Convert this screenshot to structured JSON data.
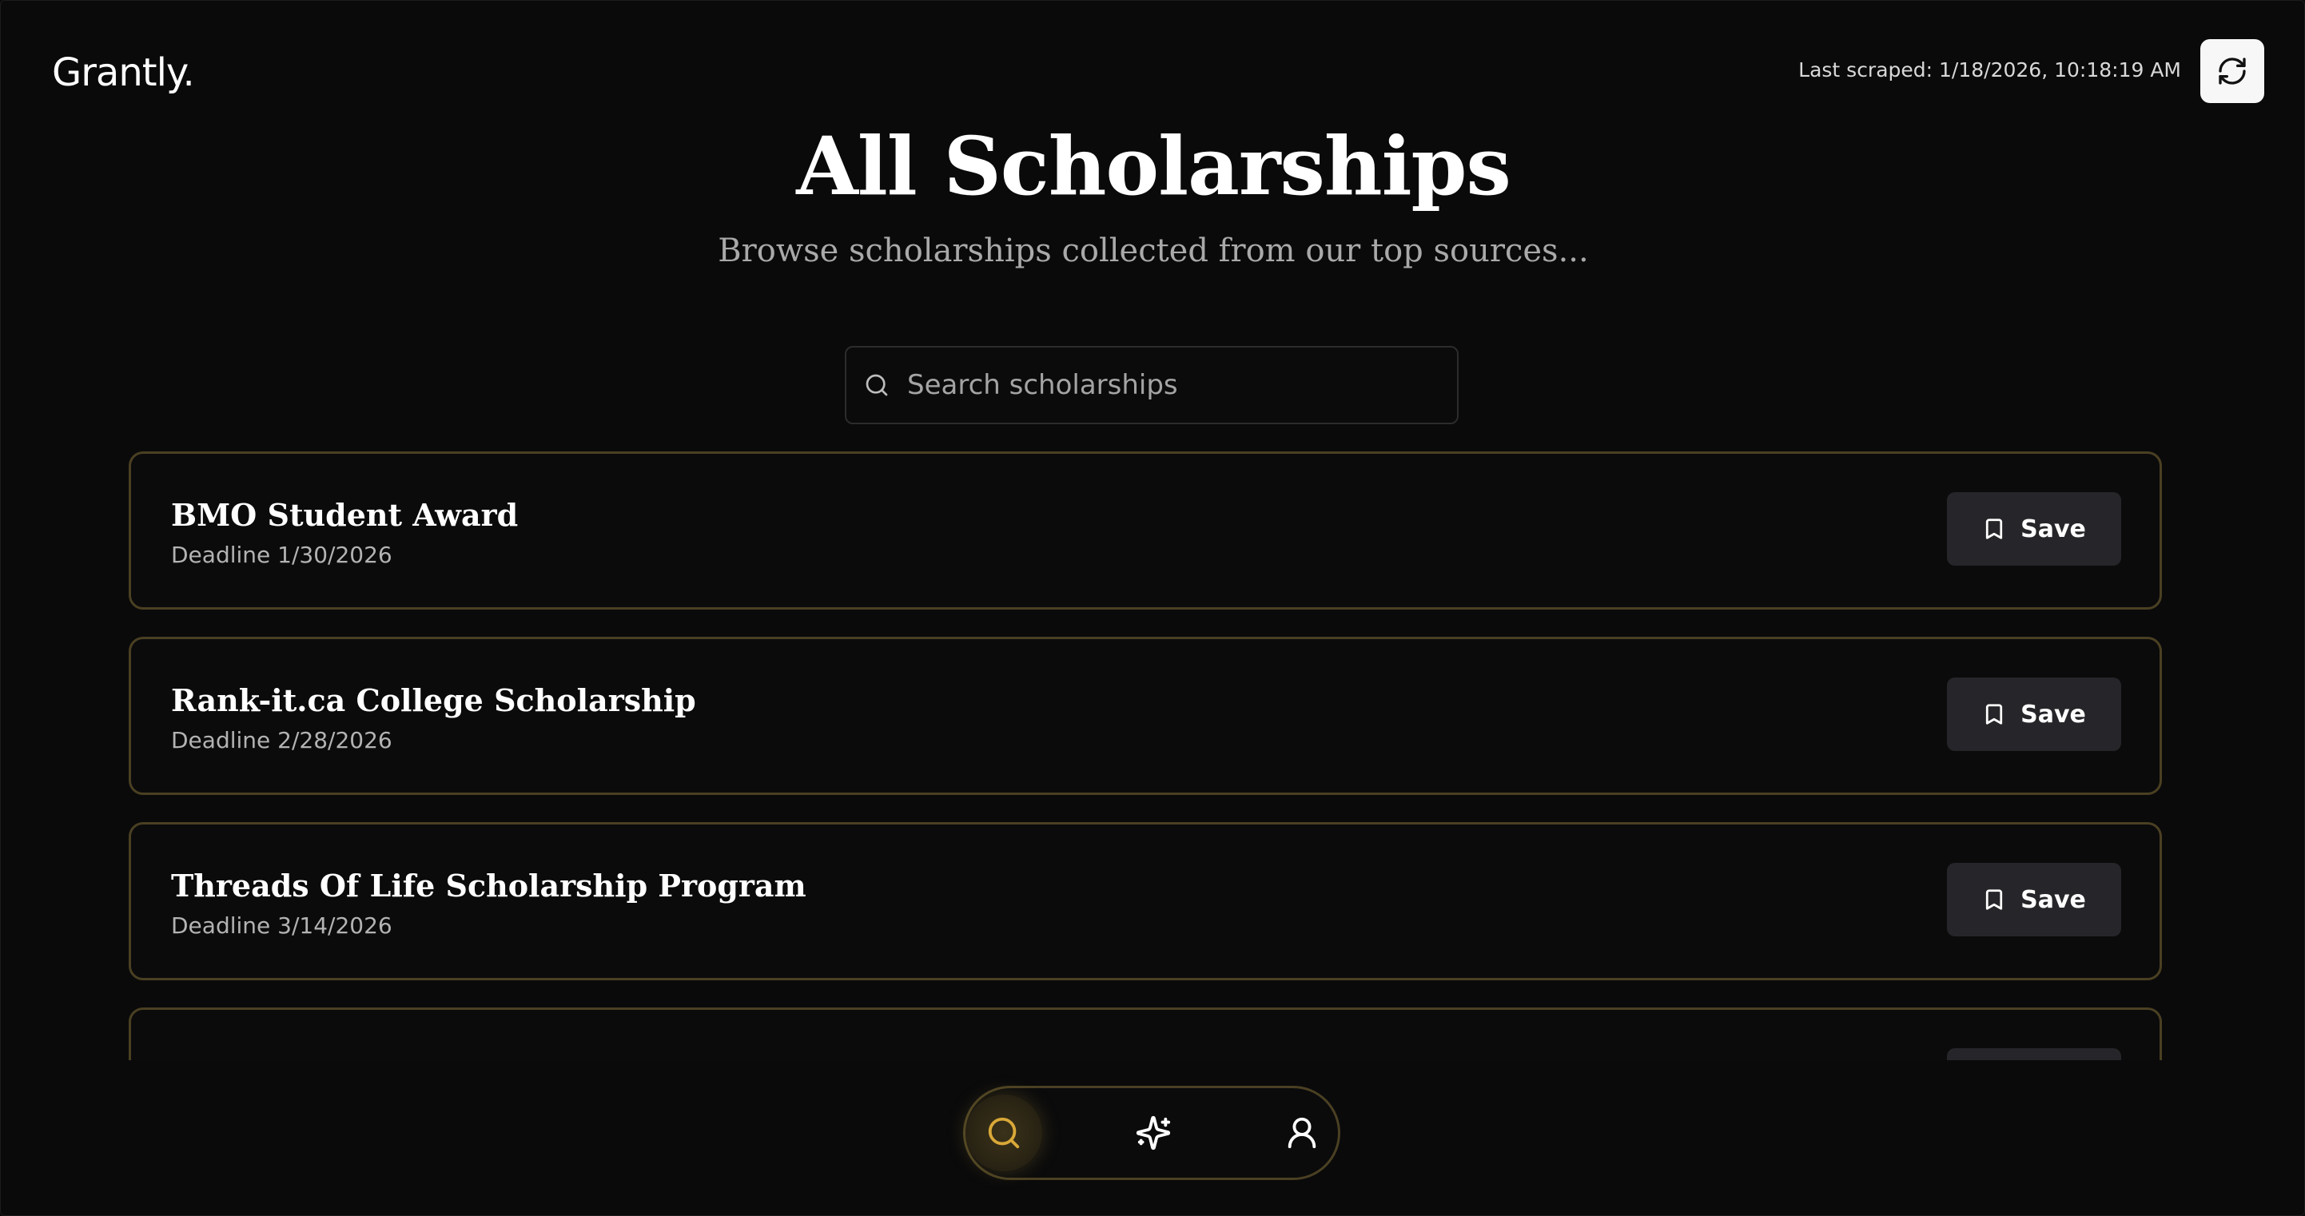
{
  "app": {
    "logo": "Grantly."
  },
  "header": {
    "last_scraped": "Last scraped: 1/18/2026, 10:18:19 AM",
    "refresh_icon": "refresh-icon"
  },
  "hero": {
    "title": "All Scholarships",
    "subtitle": "Browse scholarships collected from our top sources..."
  },
  "search": {
    "placeholder": "Search scholarships",
    "value": ""
  },
  "scholarships": [
    {
      "title": "BMO Student Award",
      "deadline": "Deadline 1/30/2026",
      "save_label": "Save"
    },
    {
      "title": "Rank-it.ca College Scholarship",
      "deadline": "Deadline 2/28/2026",
      "save_label": "Save"
    },
    {
      "title": "Threads Of Life Scholarship Program",
      "deadline": "Deadline 3/14/2026",
      "save_label": "Save"
    },
    {
      "title": "",
      "deadline": "",
      "save_label": ""
    }
  ],
  "bottom_nav": {
    "items": [
      {
        "icon": "search-icon",
        "active": true
      },
      {
        "icon": "sparkles-icon",
        "active": false
      },
      {
        "icon": "user-icon",
        "active": false
      }
    ]
  },
  "colors": {
    "background": "#0a0a0b",
    "card_border": "#4a4022",
    "accent_gold": "#d9a838",
    "button_bg": "#26262a"
  }
}
